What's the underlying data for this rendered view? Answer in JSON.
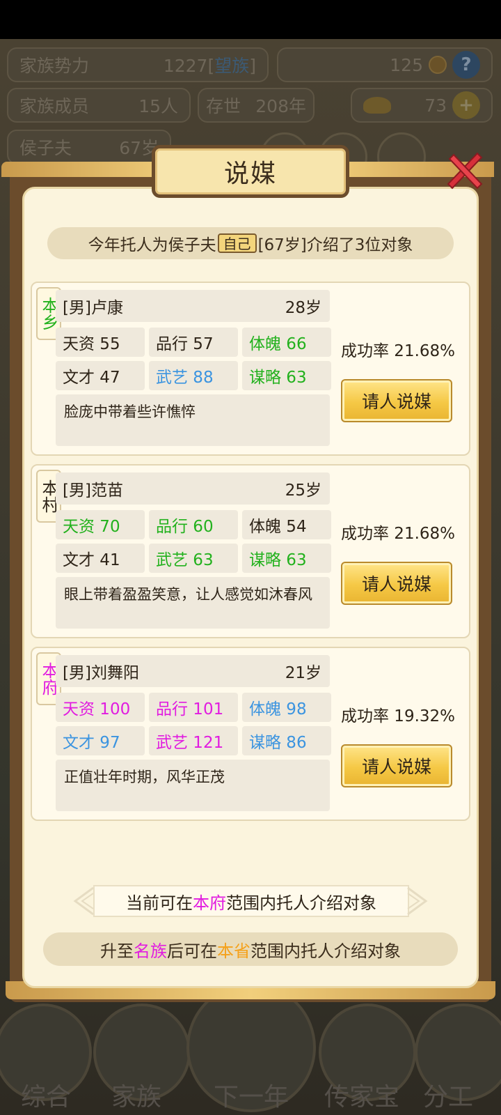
{
  "top": {
    "power_label": "家族势力",
    "power_value": "1227",
    "power_rank": "望族",
    "coins": "125",
    "help": "?",
    "members_label": "家族成员",
    "members_value": "15人",
    "age_label": "存世",
    "age_value": "208年",
    "gold": "73",
    "plus": "+",
    "patriarch_label": "侯子夫",
    "patriarch_age": "67岁"
  },
  "modal": {
    "title": "说媒",
    "intro_pre": "今年托人为侯子夫",
    "intro_tag": "自己",
    "intro_post": "[67岁]介绍了3位对象",
    "candidates": [
      {
        "region": "本乡",
        "region_color": "#22b11d",
        "name": "[男]卢康",
        "age": "28岁",
        "stats": [
          {
            "text": "天资 55",
            "color": "normal"
          },
          {
            "text": "品行 57",
            "color": "normal"
          },
          {
            "text": "体魄 66",
            "color": "green"
          },
          {
            "text": "文才 47",
            "color": "normal"
          },
          {
            "text": "武艺 88",
            "color": "blue"
          },
          {
            "text": "谋略 63",
            "color": "green"
          }
        ],
        "desc": "脸庞中带着些许憔悴",
        "rate": "成功率 21.68%",
        "button": "请人说媒"
      },
      {
        "region": "本村",
        "region_color": "#2e2418",
        "name": "[男]范苗",
        "age": "25岁",
        "stats": [
          {
            "text": "天资 70",
            "color": "green"
          },
          {
            "text": "品行 60",
            "color": "green"
          },
          {
            "text": "体魄 54",
            "color": "normal"
          },
          {
            "text": "文才 41",
            "color": "normal"
          },
          {
            "text": "武艺 63",
            "color": "green"
          },
          {
            "text": "谋略 63",
            "color": "green"
          }
        ],
        "desc": "眼上带着盈盈笑意，让人感觉如沐春风",
        "rate": "成功率 21.68%",
        "button": "请人说媒"
      },
      {
        "region": "本府",
        "region_color": "#e11ce0",
        "name": "[男]刘舞阳",
        "age": "21岁",
        "stats": [
          {
            "text": "天资 100",
            "color": "pink"
          },
          {
            "text": "品行 101",
            "color": "pink"
          },
          {
            "text": "体魄 98",
            "color": "blue"
          },
          {
            "text": "文才 97",
            "color": "blue"
          },
          {
            "text": "武艺 121",
            "color": "pink"
          },
          {
            "text": "谋略 86",
            "color": "blue"
          }
        ],
        "desc": "正值壮年时期，风华正茂",
        "rate": "成功率 19.32%",
        "button": "请人说媒"
      }
    ],
    "range_pre": "当前可在",
    "range_hl": "本府",
    "range_post": "范围内托人介绍对象",
    "upgrade_pre": "升至",
    "upgrade_hl1": "名族",
    "upgrade_mid": "后可在",
    "upgrade_hl2": "本省",
    "upgrade_post": "范围内托人介绍对象"
  },
  "bottom_nav": [
    {
      "label": "综合"
    },
    {
      "label": "家族"
    },
    {
      "label": "下一年"
    },
    {
      "label": "传家宝"
    },
    {
      "label": "分工"
    }
  ]
}
